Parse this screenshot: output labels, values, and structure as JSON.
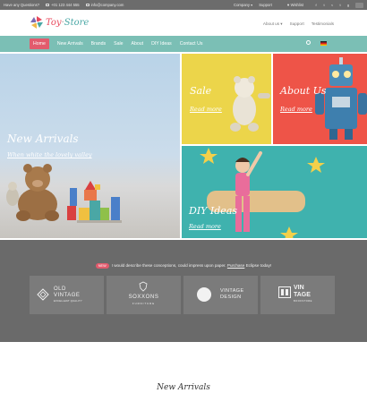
{
  "topbar": {
    "question": "Have any Questions?",
    "phone": "+01 123 444 555",
    "email": "info@company.com",
    "account": "Company",
    "support": "Support",
    "wishlist": "Wishlist"
  },
  "header": {
    "logo_part1": "Toy",
    "logo_part2": "Store",
    "nav": [
      "About us",
      "Support",
      "Testimonials"
    ]
  },
  "mainnav": {
    "items": [
      "Home",
      "New Arrivals",
      "Brands",
      "Sale",
      "About",
      "DIY Ideas",
      "Contact Us"
    ],
    "active": "Home"
  },
  "hero": {
    "main": {
      "title": "New Arrivals",
      "link": "When white the lovely valley"
    },
    "sale": {
      "title": "Sale",
      "link": "Read more"
    },
    "about": {
      "title": "About Us",
      "link": "Read more"
    },
    "diy": {
      "title": "DIY Ideas",
      "link": "Read more"
    }
  },
  "strip": {
    "badge": "NEW",
    "notice": "I would describe these conceptions, could impress upon paper.",
    "purchase": "Purchase",
    "notice_end": "Eclipse today!",
    "brands": [
      {
        "line1": "OLD",
        "line2": "VINTAGE",
        "line3": "EXCELLENT QUALITY"
      },
      {
        "line1": "SOXXONS",
        "line2": "FURNITURE"
      },
      {
        "line1": "VINTAGE",
        "line2": "DESIGN"
      },
      {
        "line1": "VIN",
        "line2": "TAGE",
        "line3": "BOOKSTORE"
      }
    ]
  },
  "section_title": "New Arrivals",
  "colors": {
    "accent": "#e25b6d",
    "nav": "#7bbfb5",
    "sale": "#ecd54a",
    "about": "#ee5448",
    "diy": "#3fb2ae",
    "strip": "#6a6a6a"
  }
}
